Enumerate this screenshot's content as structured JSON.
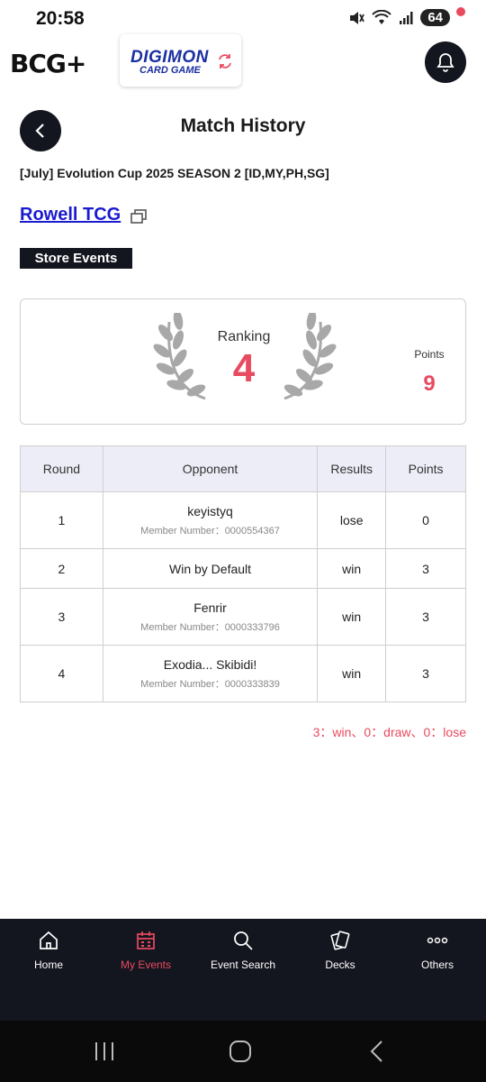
{
  "status_bar": {
    "time": "20:58",
    "battery": "64"
  },
  "header": {
    "app_logo": "BCG+",
    "game_logo_line1": "DIGIMON",
    "game_logo_line2": "CARD GAME"
  },
  "page": {
    "title": "Match History",
    "event_name": "[July] Evolution Cup 2025 SEASON 2 [ID,MY,PH,SG]",
    "store_name": "Rowell TCG",
    "event_category": "Store Events"
  },
  "ranking": {
    "label": "Ranking",
    "value": "4",
    "points_label": "Points",
    "points_value": "9"
  },
  "table": {
    "headers": {
      "round": "Round",
      "opponent": "Opponent",
      "results": "Results",
      "points": "Points"
    },
    "rows": [
      {
        "round": "1",
        "opponent": "keyistyq",
        "member": "Member Number：0000554367",
        "result": "lose",
        "points": "0"
      },
      {
        "round": "2",
        "opponent": "Win by Default",
        "member": "",
        "result": "win",
        "points": "3"
      },
      {
        "round": "3",
        "opponent": "Fenrir",
        "member": "Member Number：0000333796",
        "result": "win",
        "points": "3"
      },
      {
        "round": "4",
        "opponent": "Exodia... Skibidi!",
        "member": "Member Number：0000333839",
        "result": "win",
        "points": "3"
      }
    ]
  },
  "summary": "3：win、0：draw、0：lose",
  "bottom_nav": [
    {
      "label": "Home",
      "icon": "home-icon",
      "active": false
    },
    {
      "label": "My Events",
      "icon": "calendar-icon",
      "active": true
    },
    {
      "label": "Event Search",
      "icon": "search-icon",
      "active": false
    },
    {
      "label": "Decks",
      "icon": "cards-icon",
      "active": false
    },
    {
      "label": "Others",
      "icon": "more-icon",
      "active": false
    }
  ],
  "colors": {
    "accent": "#e84a5f",
    "dark": "#14161f",
    "link": "#1a1ad0",
    "header_bg": "#ededf7"
  }
}
